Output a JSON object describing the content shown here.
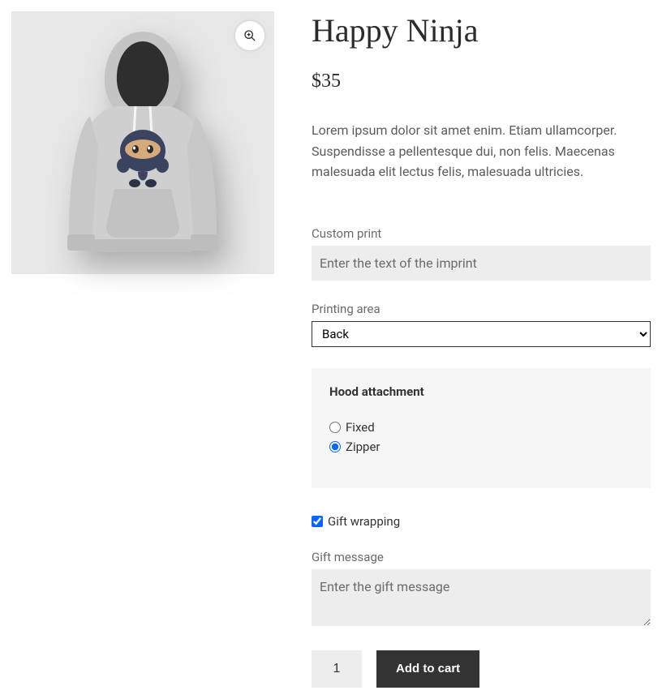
{
  "product": {
    "title": "Happy Ninja",
    "currency": "$",
    "price": "35",
    "description": "Lorem ipsum dolor sit amet enim. Etiam ullamcorper. Suspendisse a pellentesque dui, non felis. Maecenas malesuada elit lectus felis, malesuada ultricies."
  },
  "fields": {
    "custom_print": {
      "label": "Custom print",
      "placeholder": "Enter the text of the imprint",
      "value": ""
    },
    "printing_area": {
      "label": "Printing area",
      "selected": "Back"
    },
    "hood_attachment": {
      "legend": "Hood attachment",
      "options": {
        "fixed": "Fixed",
        "zipper": "Zipper"
      },
      "selected": "zipper"
    },
    "gift_wrapping": {
      "label": "Gift wrapping",
      "checked": true
    },
    "gift_message": {
      "label": "Gift message",
      "placeholder": "Enter the gift message",
      "value": ""
    }
  },
  "cart": {
    "quantity": "1",
    "add_button": "Add to cart"
  }
}
